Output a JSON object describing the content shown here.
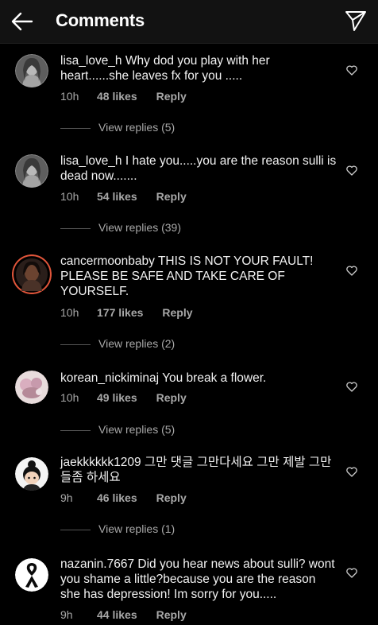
{
  "header": {
    "title": "Comments"
  },
  "comments": [
    {
      "user": "lisa_love_h",
      "text": "Why dod you play with her heart......she leaves fx for you .....",
      "time": "10h",
      "likes": "48 likes",
      "reply": "Reply",
      "replies": "View replies (5)",
      "avatar": "profile-photo"
    },
    {
      "user": "lisa_love_h",
      "text": "I hate you.....you are the reason sulli is dead now.......",
      "time": "10h",
      "likes": "54 likes",
      "reply": "Reply",
      "replies": "View replies (39)",
      "avatar": "profile-photo"
    },
    {
      "user": "cancermoonbaby",
      "text": "THIS IS NOT YOUR FAULT! PLEASE BE SAFE AND TAKE CARE OF YOURSELF.",
      "time": "10h",
      "likes": "177 likes",
      "reply": "Reply",
      "replies": "View replies (2)",
      "avatar": "profile-photo"
    },
    {
      "user": "korean_nickiminaj",
      "text": "You break a flower.",
      "time": "10h",
      "likes": "49 likes",
      "reply": "Reply",
      "replies": "View replies (5)",
      "avatar": "profile-photo"
    },
    {
      "user": "jaekkkkkk1209",
      "text": "그만 댓글 그만다세요 그만 제발 그만들좀 하세요",
      "time": "9h",
      "likes": "46 likes",
      "reply": "Reply",
      "replies": "View replies (1)",
      "avatar": "cartoon-avatar"
    },
    {
      "user": "nazanin.7667",
      "text": "Did you hear news about sulli? wont you shame a little?because you are the reason she has depression! Im sorry for you.....",
      "time": "9h",
      "likes": "44 likes",
      "reply": "Reply",
      "replies": "",
      "avatar": "black-ribbon"
    }
  ],
  "colors": {
    "background": "#000000",
    "header": "#121212",
    "muted": "#a8a8a8",
    "text": "#f2f2f2"
  }
}
